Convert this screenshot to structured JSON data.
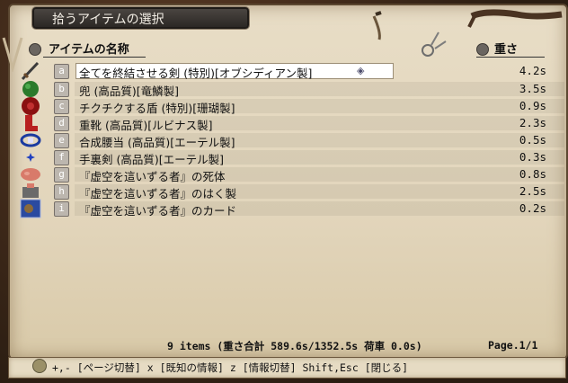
{
  "window": {
    "title": "拾うアイテムの選択"
  },
  "columns": {
    "name": "アイテムの名称",
    "weight": "重さ"
  },
  "items": [
    {
      "key": "a",
      "name": "全てを終結させる剣 (特別)[オブシディアン製]",
      "weight": "4.2s",
      "icon": "sword-icon",
      "selected": true
    },
    {
      "key": "b",
      "name": "兜 (高品質)[竜鱗製]",
      "weight": "3.5s",
      "icon": "helmet-icon"
    },
    {
      "key": "c",
      "name": "チクチクする盾 (特別)[珊瑚製]",
      "weight": "0.9s",
      "icon": "shield-icon"
    },
    {
      "key": "d",
      "name": "重靴 (高品質)[ルビナス製]",
      "weight": "2.3s",
      "icon": "boots-icon"
    },
    {
      "key": "e",
      "name": "合成腰当 (高品質)[エーテル製]",
      "weight": "0.5s",
      "icon": "belt-icon"
    },
    {
      "key": "f",
      "name": "手裏剣 (高品質)[エーテル製]",
      "weight": "0.3s",
      "icon": "shuriken-icon"
    },
    {
      "key": "g",
      "name": "『虚空を這いずる者』の死体",
      "weight": "0.8s",
      "icon": "corpse-icon"
    },
    {
      "key": "h",
      "name": "『虚空を這いずる者』のはく製",
      "weight": "2.5s",
      "icon": "stuffed-icon"
    },
    {
      "key": "i",
      "name": "『虚空を這いずる者』のカード",
      "weight": "0.2s",
      "icon": "card-icon"
    }
  ],
  "summary": "9 items  (重さ合計 589.6s/1352.5s  荷車 0.0s)",
  "page": "Page.1/1",
  "help": "+,- [ページ切替]  x [既知の情報]  z [情報切替]  Shift,Esc [閉じる]"
}
